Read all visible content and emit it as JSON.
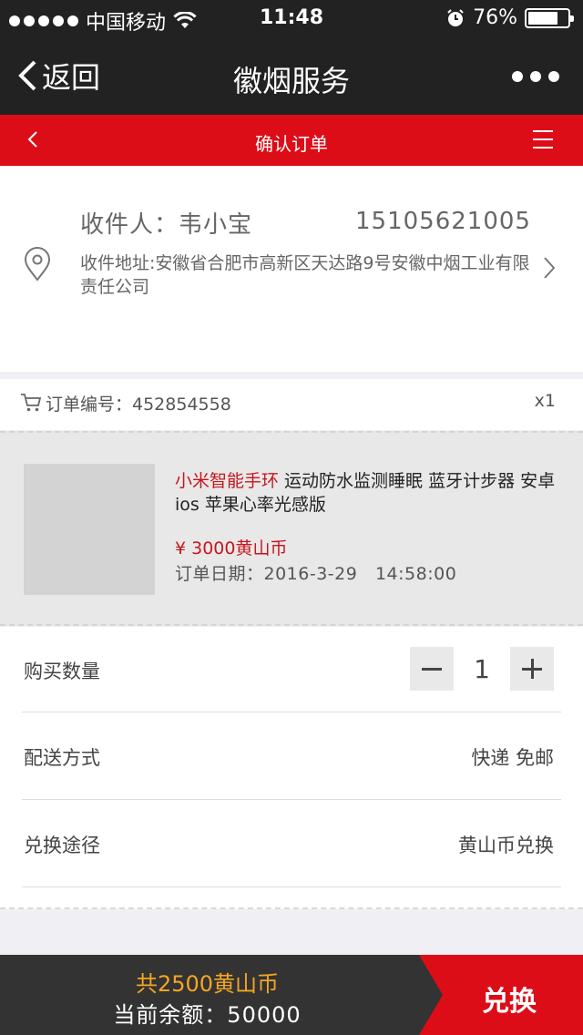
{
  "statusbar": {
    "carrier": "中国移动",
    "time": "11:48",
    "battery": "76%",
    "battery_level": 0.76
  },
  "navbar": {
    "back_label": "返回",
    "title": "徽烟服务"
  },
  "subheader": {
    "title": "确认订单"
  },
  "address": {
    "recipient": "收件人：韦小宝",
    "phone": "15105621005",
    "address": "收件地址:安徽省合肥市高新区天达路9号安徽中烟工业有限责任公司"
  },
  "order": {
    "number": "订单编号：452854558",
    "quantity": "x1"
  },
  "product": {
    "name_highlight": "小米智能手环",
    "name_rest": " 运动防水监测睡眠 蓝牙计步器 安卓 ios 苹果心率光感版",
    "price": "¥ 3000黄山币",
    "date": "订单日期：2016-3-29   14:58:00"
  },
  "details": {
    "quantity_label": "购买数量",
    "quantity_value": "1",
    "shipping_label": "配送方式",
    "shipping_value": "快递 免邮",
    "exchange_label": "兑换途径",
    "exchange_value": "黄山币兑换"
  },
  "footer": {
    "total": "共2500黄山币",
    "balance": "当前余额：50000",
    "redeem_label": "兑换"
  },
  "colors": {
    "accent": "#dd0d18",
    "dark": "#222222",
    "price": "#c8161e",
    "total": "#f5a623"
  }
}
